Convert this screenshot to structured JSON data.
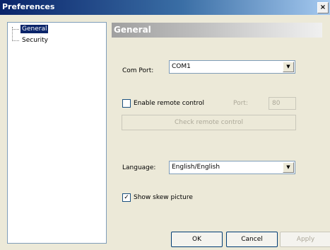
{
  "window": {
    "title": "Preferences",
    "close_glyph": "×"
  },
  "sidebar": {
    "items": [
      {
        "label": "General",
        "selected": true
      },
      {
        "label": "Security",
        "selected": false
      }
    ]
  },
  "section": {
    "title": "General"
  },
  "com_port": {
    "label": "Com Port:",
    "value": "COM1"
  },
  "remote": {
    "checkbox_label": "Enable remote control",
    "checked": false,
    "port_label": "Port:",
    "port_value": "80",
    "check_button_label": "Check remote control"
  },
  "language": {
    "label": "Language:",
    "value": "English/English"
  },
  "skew": {
    "checkbox_label": "Show skew picture",
    "checked": true,
    "check_glyph": "✓"
  },
  "footer": {
    "ok_label": "OK",
    "cancel_label": "Cancel",
    "apply_label": "Apply"
  },
  "icons": {
    "dropdown": "▼"
  },
  "colors": {
    "titlebar_start": "#0a246a",
    "selection": "#0a246a",
    "dialog_bg": "#ece9d8",
    "disabled_text": "#aca899"
  }
}
